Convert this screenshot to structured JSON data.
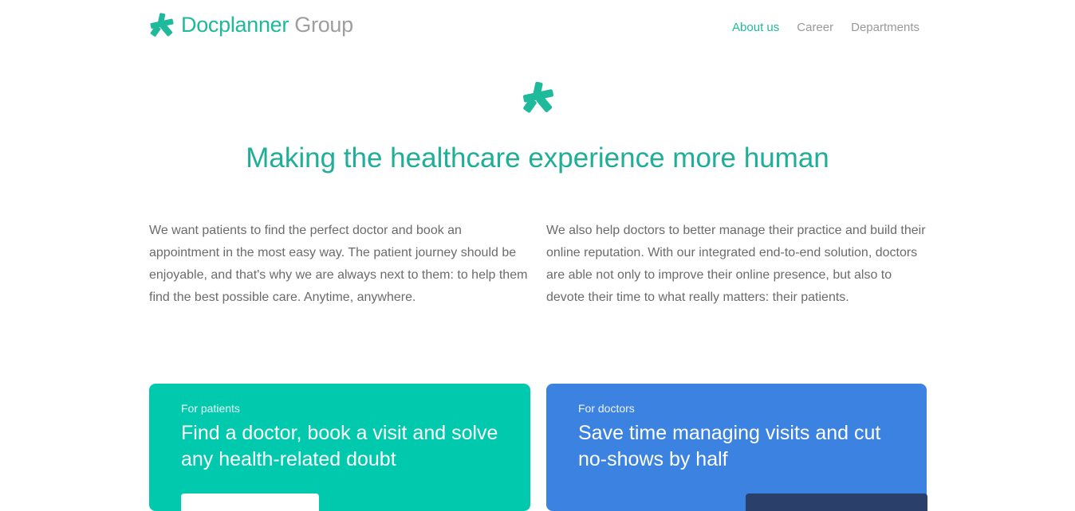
{
  "header": {
    "logo_primary": "Docplanner",
    "logo_secondary": "Group",
    "nav": [
      {
        "label": "About us",
        "active": true
      },
      {
        "label": "Career",
        "active": false
      },
      {
        "label": "Departments",
        "active": false
      }
    ]
  },
  "hero": {
    "icon": "docplanner-star-icon",
    "headline": "Making the healthcare experience more human"
  },
  "intro": {
    "left": "We want patients to find the perfect doctor and book an appointment in the most easy way. The patient journey should be enjoyable, and that's why we are always next to them: to help them find the best possible care. Anytime, anywhere.",
    "right": "We also help doctors to better manage their practice and build their online reputation. With our integrated end-to-end solution, doctors are able not only to improve their online presence, but also to devote their time to what really matters: their patients."
  },
  "cards": {
    "patients": {
      "kicker": "For patients",
      "title": "Find a doctor, book a visit and solve any health-related doubt",
      "color": "#00c9ad"
    },
    "doctors": {
      "kicker": "For doctors",
      "title": "Save time managing visits and cut no-shows by half",
      "color": "#3c82e0"
    }
  },
  "colors": {
    "brand": "#1fb99c",
    "text": "#6b6b6b",
    "nav_inactive": "#999999"
  }
}
